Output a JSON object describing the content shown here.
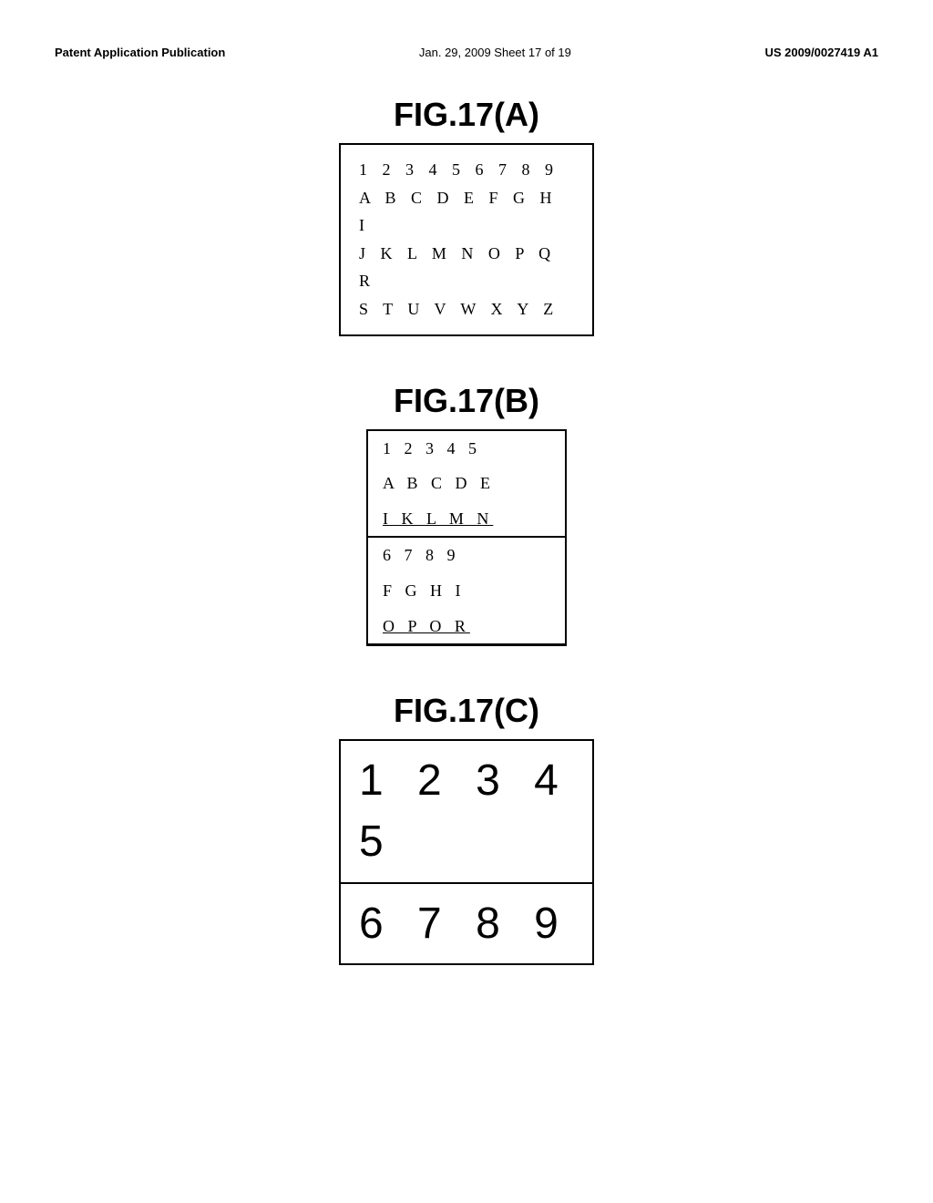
{
  "header": {
    "left_label": "Patent Application Publication",
    "center_label": "Jan. 29, 2009  Sheet 17 of 19",
    "right_label": "US 2009/0027419 A1"
  },
  "figures": {
    "fig_a": {
      "title": "FIG.17(A)",
      "rows": [
        "1 2 3 4 5 6 7 8 9",
        "A B C D E F G H I",
        "J K L M N O P Q R",
        "S T U V W X Y Z"
      ]
    },
    "fig_b": {
      "title": "FIG.17(B)",
      "rows": [
        {
          "text": "1  2  3  4  5",
          "style": "normal"
        },
        {
          "text": "A  B  C  D  E",
          "style": "normal"
        },
        {
          "text": "I  K  L  M N",
          "style": "underline-separator"
        },
        {
          "text": "6  7  8  9",
          "style": "normal"
        },
        {
          "text": "F  G  H  I",
          "style": "normal"
        },
        {
          "text": "O  P  O  R",
          "style": "underline"
        }
      ]
    },
    "fig_c": {
      "title": "FIG.17(C)",
      "rows": [
        {
          "text": "1  2  3  4  5",
          "style": "border-bottom"
        },
        {
          "text": "6  7  8  9",
          "style": "normal"
        }
      ]
    }
  }
}
